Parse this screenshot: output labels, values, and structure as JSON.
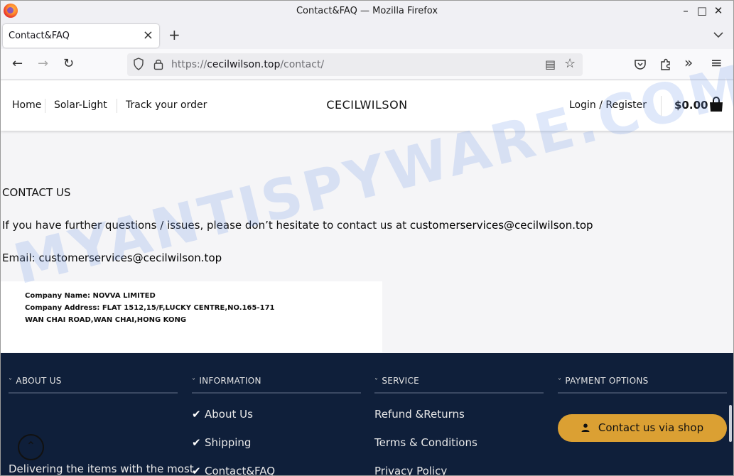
{
  "window": {
    "title": "Contact&FAQ — Mozilla Firefox",
    "controls": {
      "minimize": "–",
      "maximize": "□",
      "close": "✕"
    }
  },
  "tabs": [
    {
      "label": "Contact&FAQ",
      "active": true
    }
  ],
  "toolbar": {
    "new_tab": "+",
    "tab_list": "⌄",
    "back": "←",
    "forward": "→",
    "reload": "↻",
    "url_scheme": "https://",
    "url_host": "cecilwilson.top",
    "url_path": "/contact/",
    "reader_icon": "▤",
    "bookmark_icon": "☆",
    "more_tools": "»",
    "menu": "≡"
  },
  "site_header": {
    "menu": [
      "Home",
      "Solar-Light",
      "Track your order"
    ],
    "logo": "CECILWILSON",
    "login": "Login / Register",
    "cart_total": "$0.00"
  },
  "content": {
    "heading": "CONTACT US",
    "paragraph_prefix": "If you have further questions / issues, please don’t hesitate to contact us at ",
    "paragraph_email": "customerservices@cecilwilson.top",
    "email_label": "Email: ",
    "email_value": "customerservices@cecilwilson.top",
    "company_name_label": "Company Name: ",
    "company_name": "NOVVA LIMITED",
    "company_address_label": "Company Address: ",
    "company_address_line1": "FLAT 1512,15/F,LUCKY CENTRE,NO.165-171",
    "company_address_line2": "WAN CHAI ROAD,WAN CHAI,HONG KONG"
  },
  "footer": {
    "columns": [
      {
        "title": "ABOUT US"
      },
      {
        "title": "INFORMATION",
        "links": [
          "About Us",
          "Shipping",
          "Contact&FAQ"
        ]
      },
      {
        "title": "SERVICE",
        "links": [
          "Refund &Returns",
          "Terms & Conditions",
          "Privacy Policy"
        ]
      },
      {
        "title": "PAYMENT OPTIONS"
      }
    ],
    "about_text": "Delivering the items with the most",
    "contact_button": "Contact us via shop",
    "back_to_top": "⌃"
  },
  "watermark": "MYANTISPYWARE.COM",
  "colors": {
    "footer_bg": "#0f1f3a",
    "contact_button": "#dba033",
    "content_bg": "#f5f5f7"
  }
}
